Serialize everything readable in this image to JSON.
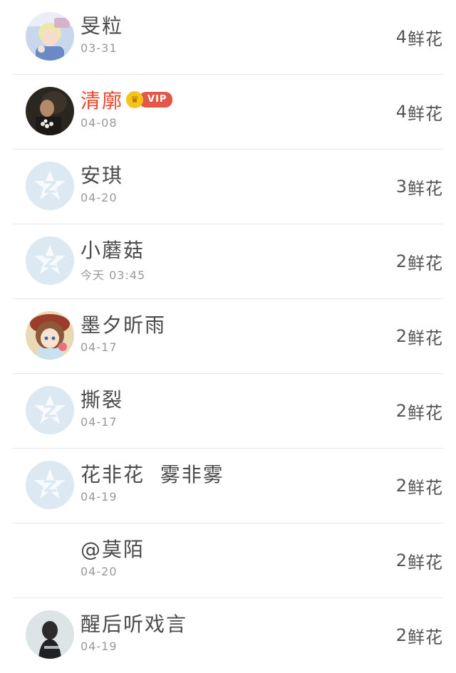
{
  "flower_unit": "鲜花",
  "rows": [
    {
      "name": "旻粒",
      "date": "03-31",
      "count": "4",
      "avatar": "photo-blond",
      "vip": false
    },
    {
      "name": "清廓",
      "date": "04-08",
      "count": "4",
      "avatar": "photo-dark",
      "vip": true,
      "vip_label": "VIP"
    },
    {
      "name": "安琪",
      "date": "04-20",
      "count": "3",
      "avatar": "qzone-star",
      "vip": false
    },
    {
      "name": "小蘑菇",
      "date": "今天  03:45",
      "count": "2",
      "avatar": "qzone-star",
      "vip": false
    },
    {
      "name": "墨夕昕雨",
      "date": "04-17",
      "count": "2",
      "avatar": "photo-anime",
      "vip": false
    },
    {
      "name": "撕裂",
      "date": "04-17",
      "count": "2",
      "avatar": "qzone-star",
      "vip": false
    },
    {
      "name": "花非花  雾非雾",
      "date": "04-19",
      "count": "2",
      "avatar": "qzone-star",
      "vip": false
    },
    {
      "name": "@莫陌",
      "date": "04-20",
      "count": "2",
      "avatar": "none",
      "vip": false
    },
    {
      "name": "醒后听戏言",
      "date": "04-19",
      "count": "2",
      "avatar": "photo-girl",
      "vip": false
    }
  ],
  "colors": {
    "vip_name": "#e8482f",
    "vip_badge": "#e35748",
    "crown": "#f6c21c",
    "placeholder": "#dde9f2"
  }
}
